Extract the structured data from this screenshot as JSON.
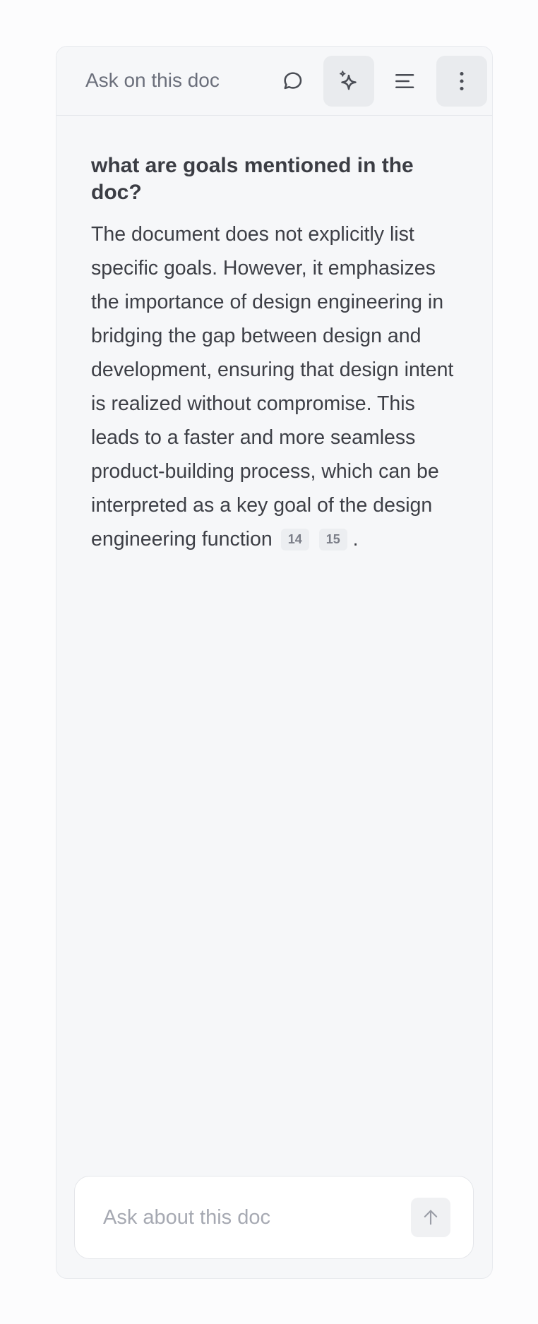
{
  "header": {
    "title": "Ask on this doc",
    "buttons": [
      {
        "icon": "chat-bubble-icon",
        "active": false
      },
      {
        "icon": "sparkle-icon",
        "active": true
      },
      {
        "icon": "outline-lines-icon",
        "active": false
      },
      {
        "icon": "vertical-dots-icon",
        "active": true
      }
    ]
  },
  "conversation": {
    "question": "what are goals mentioned in the doc?",
    "answer": "The document does not explicitly list specific goals. However, it emphasizes the importance of design engineering in bridging the gap between design and development, ensuring that design intent is realized without compromise. This leads to a faster and more seamless product-building process, which can be interpreted as a key goal of the design engineering function",
    "citations": [
      "14",
      "15"
    ],
    "answer_end": "."
  },
  "composer": {
    "placeholder": "Ask about this doc",
    "value": "",
    "send_icon": "arrow-up-icon"
  },
  "colors": {
    "panel_background": "#f6f7f9",
    "active_button": "#e9ebee",
    "text": "#3d3f46",
    "muted_text": "#6b6f7b",
    "placeholder": "#a6a9b2"
  }
}
